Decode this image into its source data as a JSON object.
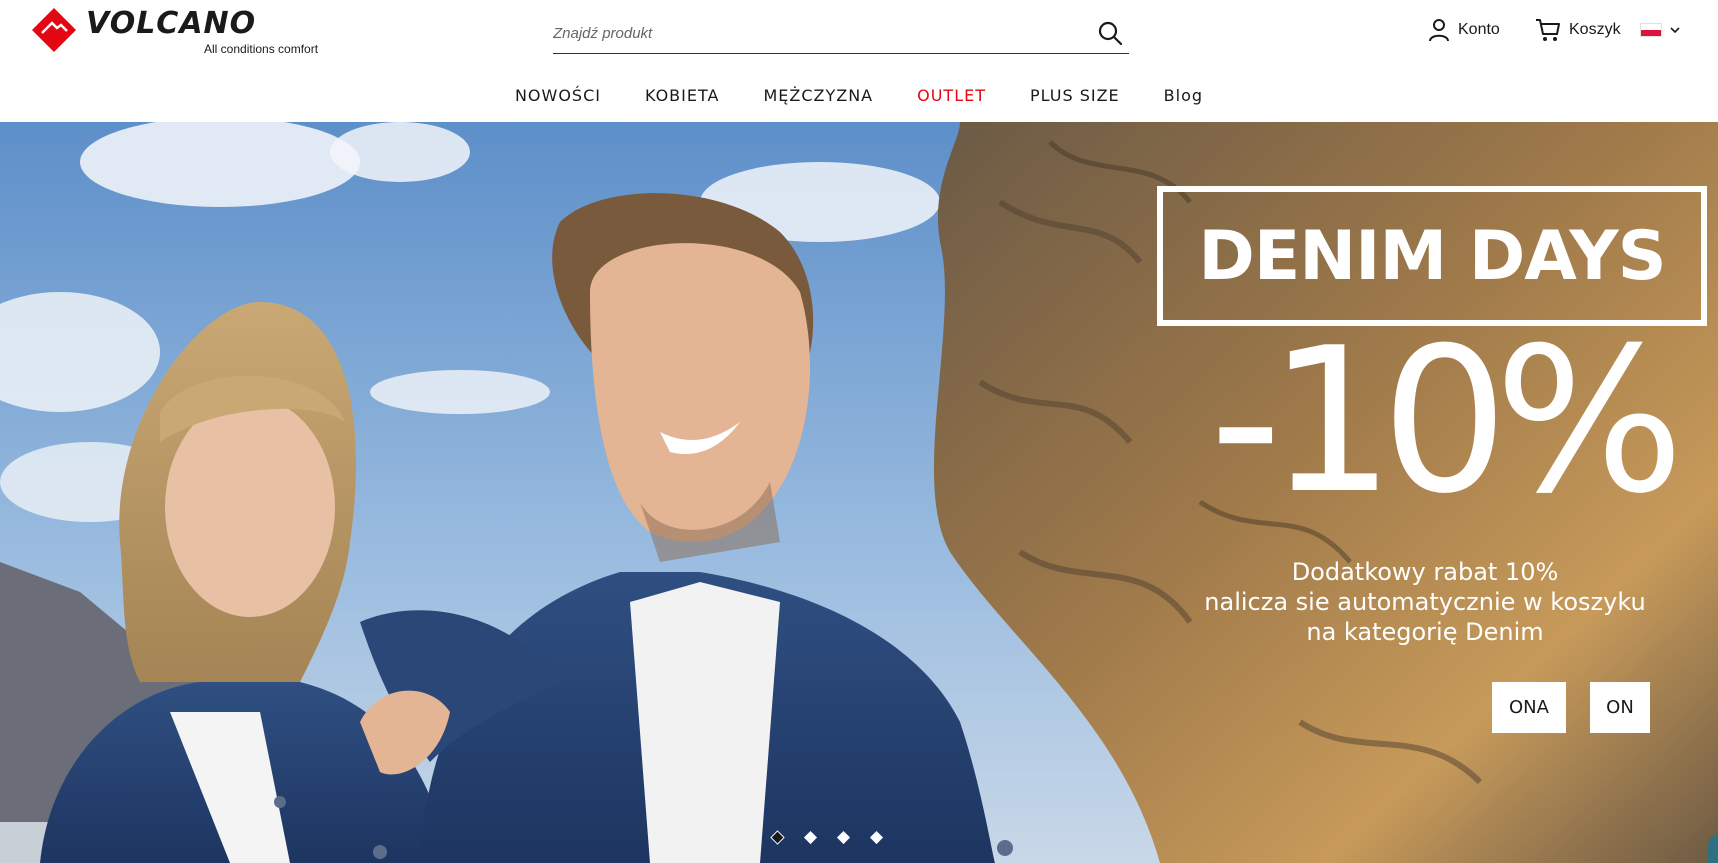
{
  "brand": {
    "name": "VOLCANO",
    "tagline": "All conditions comfort"
  },
  "header": {
    "search_placeholder": "Znajdź produkt",
    "account_label": "Konto",
    "cart_label": "Koszyk",
    "language": "Polski"
  },
  "nav": {
    "items": [
      {
        "label": "NOWOŚCI"
      },
      {
        "label": "KOBIETA"
      },
      {
        "label": "MĘŻCZYZNA"
      },
      {
        "label": "OUTLET"
      },
      {
        "label": "PLUS SIZE"
      },
      {
        "label": "Blog"
      }
    ]
  },
  "hero": {
    "promo_title": "DENIM DAYS",
    "discount": "-10%",
    "promo_line1": "Dodatkowy rabat 10%",
    "promo_line2": "nalicza sie automatycznie w koszyku",
    "promo_line3": "na kategorię Denim",
    "button_ona": "ONA",
    "button_on": "ON",
    "slides_total": 4,
    "active_slide": 1
  },
  "colors": {
    "brand_red": "#e30613",
    "outlet_red": "#e30613",
    "text": "#1a1a1a"
  },
  "icons": [
    "logo-diamond-icon",
    "search-icon",
    "user-icon",
    "cart-icon",
    "poland-flag-icon",
    "chevron-down-icon"
  ]
}
